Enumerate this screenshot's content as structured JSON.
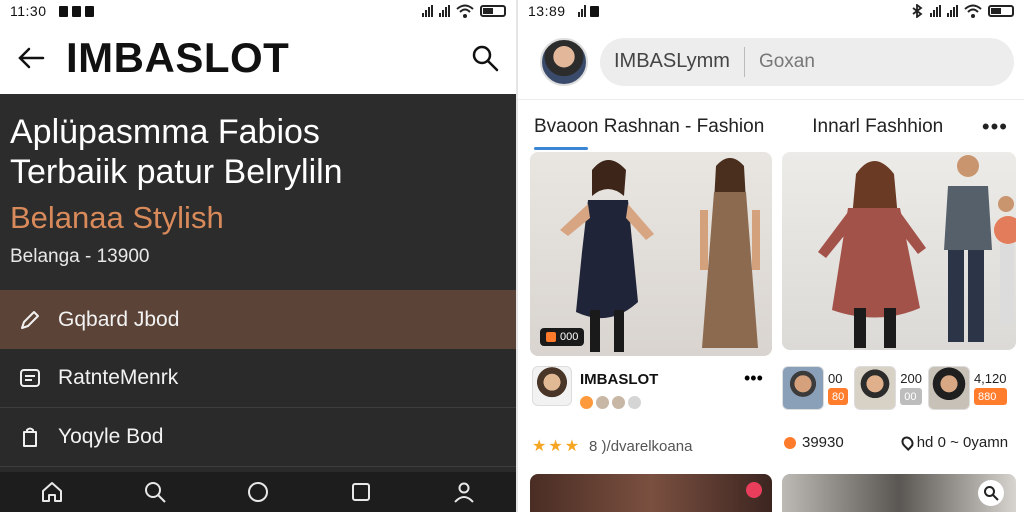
{
  "left": {
    "status": {
      "time": "11:30"
    },
    "appbar": {
      "title": "IMBASLOT"
    },
    "hero": {
      "line1": "Aplüpasmma Fabios",
      "line2": "Terbaiik patur Belryliln",
      "subtitle": "Belanaa Stylish",
      "price": "Belanga - 13900"
    },
    "menu": [
      {
        "label": "Gqbard Jbod",
        "icon": "pencil-icon"
      },
      {
        "label": "RatnteMenrk",
        "icon": "list-icon"
      },
      {
        "label": "Yoqyle Bod",
        "icon": "bag-icon"
      }
    ],
    "bottom_nav": [
      "home-icon",
      "search-icon",
      "circle-icon",
      "square-icon",
      "profile-icon"
    ]
  },
  "right": {
    "status": {
      "time": "13:89"
    },
    "search": {
      "text": "IMBASLymm",
      "placeholder": "Goxan"
    },
    "tabs": {
      "first": "Bvaoon Rashnan - Fashion",
      "second": "Innarl Fashhion",
      "more": "•••"
    },
    "card1": {
      "badge": "000"
    },
    "post1": {
      "name": "IMBASLOT",
      "more": "•••"
    },
    "mini": [
      {
        "top": "00",
        "tag": "80"
      },
      {
        "top": "200",
        "tag": "00"
      },
      {
        "top": "4,120",
        "tag": "880"
      }
    ],
    "rating": {
      "text": "8 )/dvarelkoana"
    },
    "stats": {
      "views": "39930",
      "location": "hd 0 ~ 0yamn"
    },
    "colors": {
      "accent": "#3a86d4",
      "orange": "#ff7d2d",
      "menu_active": "#5b4437",
      "hero_subtitle": "#d98a5a"
    }
  }
}
